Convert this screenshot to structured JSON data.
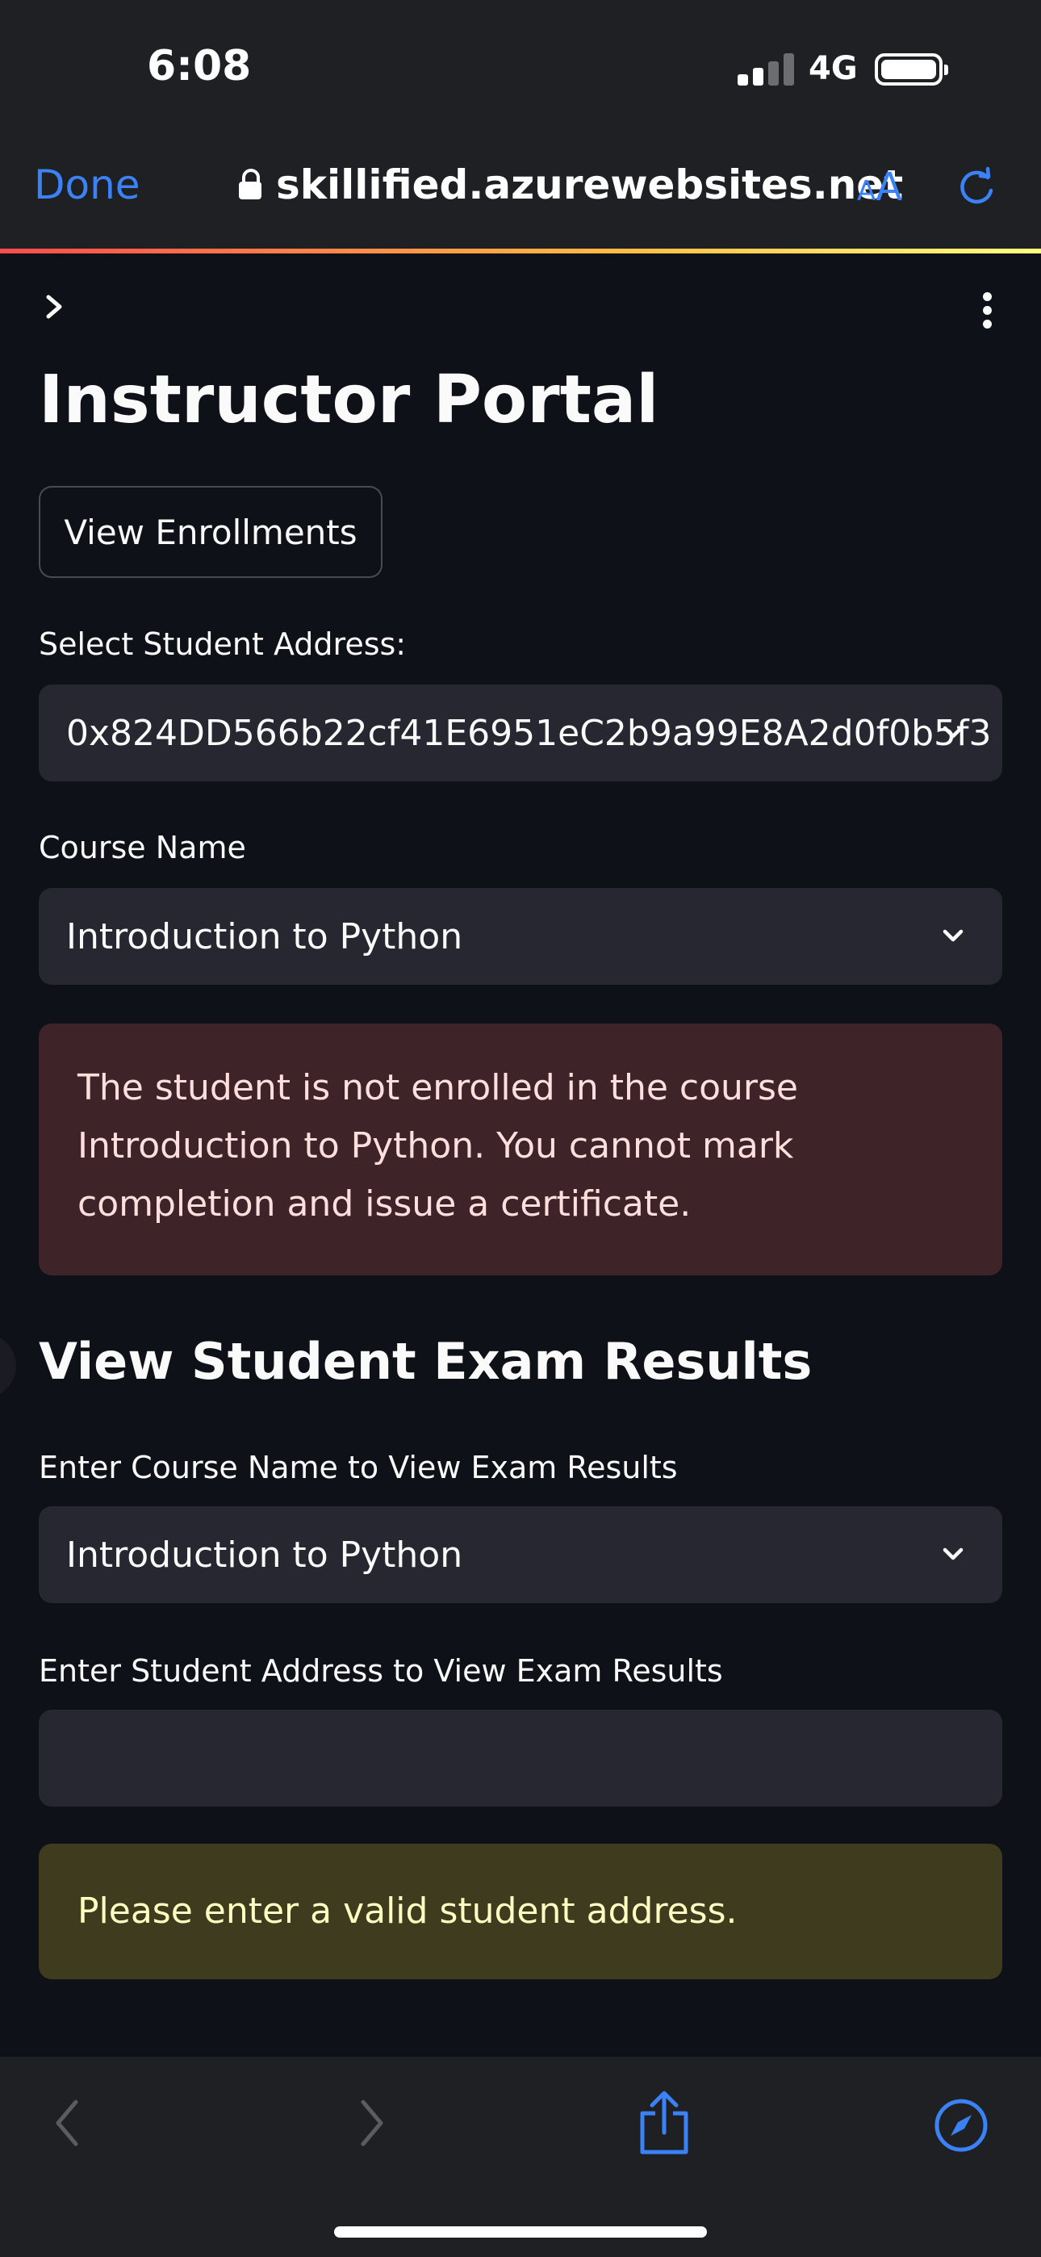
{
  "status_bar": {
    "time": "6:08",
    "network": "4G"
  },
  "browser": {
    "done_label": "Done",
    "url": "skillified.azurewebsites.net",
    "text_size_small": "A",
    "text_size_large": "A"
  },
  "page": {
    "title": "Instructor Portal",
    "view_enrollments_label": "View Enrollments",
    "student_address_label": "Select Student Address:",
    "student_address_value": "0x824DD566b22cf41E6951eC2b9a99E8A2d0f0b5f3",
    "course_name_label": "Course Name",
    "course_name_value": "Introduction to Python",
    "error_message": "The student is not enrolled in the course Introduction to Python. You cannot mark completion and issue a certificate.",
    "exam_section": {
      "heading": "View Student Exam Results",
      "course_label": "Enter Course Name to View Exam Results",
      "course_value": "Introduction to Python",
      "address_label": "Enter Student Address to View Exam Results",
      "address_value": "",
      "warning_message": "Please enter a valid student address."
    }
  },
  "colors": {
    "accent_blue": "#3b82f6",
    "background": "#0e1117",
    "input_bg": "#262730",
    "error_bg": "#3e2428",
    "warning_bg": "#3e3b1f"
  }
}
